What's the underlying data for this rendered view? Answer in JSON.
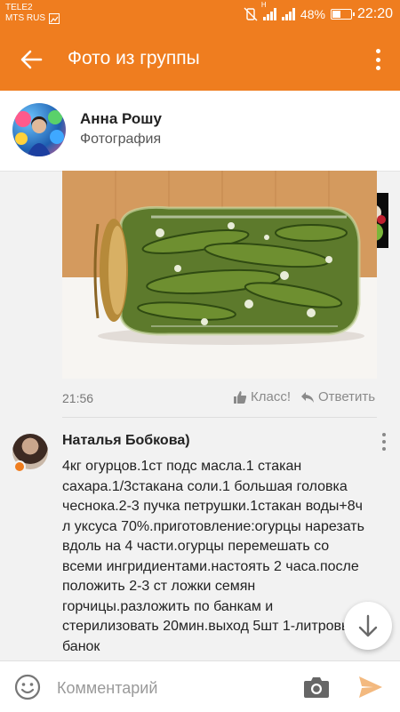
{
  "status": {
    "carrier1": "TELE2",
    "carrier2": "MTS RUS",
    "battery": "48%",
    "battery_level": 0.48,
    "time": "22:20",
    "network_label": "H"
  },
  "appbar": {
    "title": "Фото из группы"
  },
  "post": {
    "author_name": "Анна Рошу",
    "subtitle": "Фотография",
    "time": "21:56",
    "like_label": "Класс!",
    "reply_label": "Ответить"
  },
  "comment": {
    "author": "Наталья Бобкова)",
    "text": "4кг огурцов.1ст подс масла.1 стакан сахара.1/3стакана соли.1 большая головка чеснока.2-3 пучка петрушки.1стакан воды+8ч л уксуса 70%.приготовление:огурцы нарезать вдоль на 4 части.огурцы перемешать со всеми ингридиентами.настоять 2 часа.после положить 2-3 ст ложки семян горчицы.разложить по банкам и стерилизовать 20мин.выход 5шт 1-литровых банок"
  },
  "composer": {
    "placeholder": "Комментарий"
  },
  "colors": {
    "accent": "#ef7d1f"
  },
  "icons": {
    "back": "arrow-left-icon",
    "menu": "more-vertical-icon",
    "like": "thumbs-up-icon",
    "reply": "reply-icon",
    "scroll": "arrow-down-icon",
    "emoji": "smiley-icon",
    "camera": "camera-icon",
    "send": "send-icon"
  }
}
